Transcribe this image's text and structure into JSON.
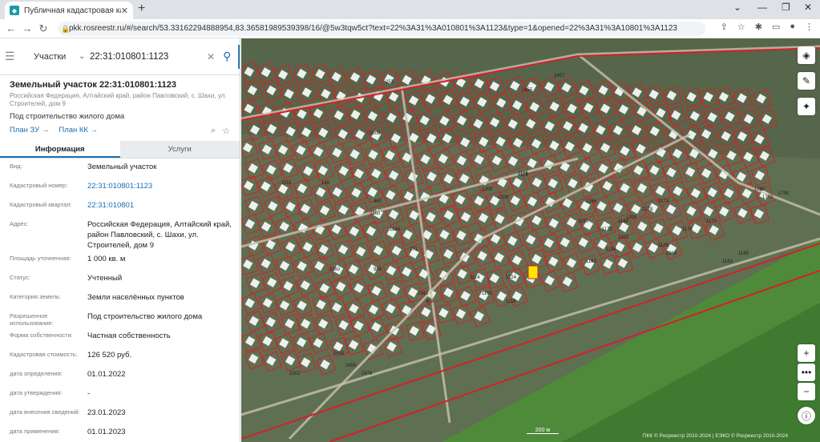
{
  "browser": {
    "tab_title": "Публичная кадастровая карта",
    "url": "pkk.rosreestr.ru/#/search/53.33162294888954,83.36581989539398/16/@5w3tqw5ct?text=22%3A31%3A010801%3A1123&type=1&opened=22%3A31%3A10801%3A1123"
  },
  "search": {
    "type": "Участки",
    "query": "22:31:010801:1123"
  },
  "parcel": {
    "title": "Земельный участок 22:31:010801:1123",
    "address": "Российская Федерация, Алтайский край, район Павловский, с. Шахи, ул. Строителей, дом 9",
    "use": "Под строительство жилого дома",
    "plan_zu": "План ЗУ →",
    "plan_kk": "План КК →"
  },
  "tabs": {
    "info": "Информация",
    "services": "Услуги"
  },
  "props": [
    {
      "label": "Вид:",
      "value": "Земельный участок",
      "link": false
    },
    {
      "label": "Кадастровый номер:",
      "value": "22:31:010801:1123",
      "link": true
    },
    {
      "label": "Кадастровый квартал:",
      "value": "22:31:010801",
      "link": true
    },
    {
      "label": "Адрес:",
      "value": "Российская Федерация, Алтайский край, район Павловский, с. Шахи, ул. Строителей, дом 9",
      "link": false
    },
    {
      "label": "Площадь уточненная:",
      "value": "1 000 кв. м",
      "link": false
    },
    {
      "label": "Статус:",
      "value": "Учтенный",
      "link": false
    },
    {
      "label": "Категория земель:",
      "value": "Земли населённых пунктов",
      "link": false
    },
    {
      "label": "Разрешенное использование:",
      "value": "Под строительство жилого дома",
      "link": false
    },
    {
      "label": "Форма собственности:",
      "value": "Частная собственность",
      "link": false
    },
    {
      "label": "Кадастровая стоимость:",
      "value": "126 520 руб.",
      "link": false
    },
    {
      "label": "дата определения:",
      "value": "01.01.2022",
      "link": false
    },
    {
      "label": "дата утверждения:",
      "value": "-",
      "link": false
    },
    {
      "label": "дата внесения сведений:",
      "value": "23.01.2023",
      "link": false
    },
    {
      "label": "дата применения:",
      "value": "01.01.2023",
      "link": false
    }
  ],
  "map": {
    "scale": "200 м",
    "copyright": "ПКК © Росреестр 2010-2024 | ЕЭКО © Росреестр 2010-2024",
    "labels": [
      "253",
      "2457",
      "2455",
      "1106",
      "1112",
      "169",
      "1006",
      "1002",
      "1160",
      "2342",
      "1106",
      "969",
      "460",
      "2360",
      "1194",
      "771",
      "1200",
      "1206",
      "1166",
      "1202",
      "1172",
      "1206",
      "1186",
      "1194",
      "1182",
      "1144",
      "1126",
      "2268",
      "2178",
      "2174",
      "1176",
      "1170",
      "1780",
      "1790",
      "1779",
      "1163",
      "1165",
      "2476",
      "2459",
      "2455",
      "1124",
      "1192",
      "1118",
      "1114",
      "408"
    ]
  }
}
